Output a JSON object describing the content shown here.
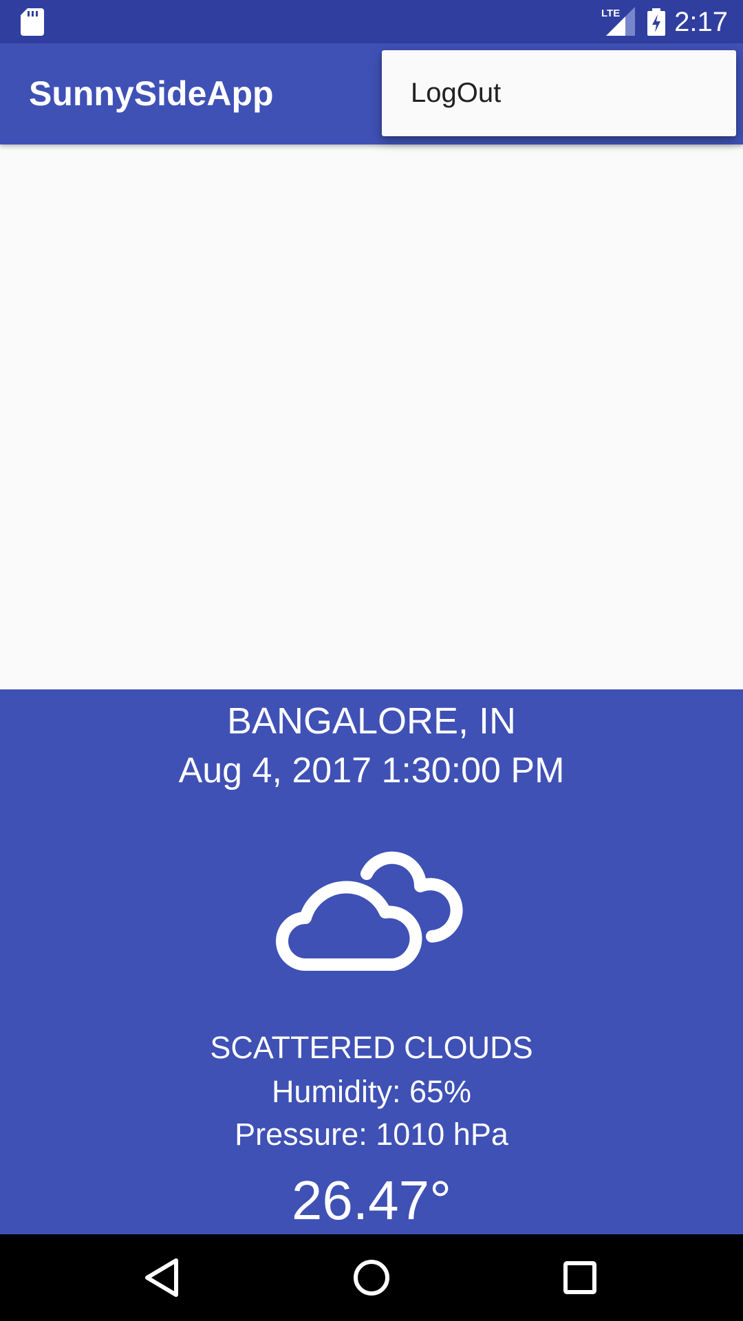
{
  "status_bar": {
    "time": "2:17",
    "network_label": "LTE",
    "icons": [
      "sd-card-icon",
      "lte-signal-icon",
      "battery-charging-icon"
    ]
  },
  "app_bar": {
    "title": "SunnySideApp"
  },
  "overflow_menu": {
    "items": [
      {
        "label": "LogOut"
      }
    ]
  },
  "weather": {
    "city": "BANGALORE, IN",
    "date_time": "Aug 4, 2017 1:30:00 PM",
    "icon": "scattered-clouds-icon",
    "description": "SCATTERED CLOUDS",
    "humidity": "Humidity: 65%",
    "pressure": "Pressure: 1010 hPa",
    "temperature": "26.47°"
  },
  "nav_bar": {
    "buttons": [
      "back-icon",
      "home-icon",
      "recents-icon"
    ]
  },
  "colors": {
    "primary": "#3f51b5",
    "primary_dark": "#303f9f",
    "background": "#fafafa",
    "menu_text": "#212121",
    "on_primary": "#ffffff"
  }
}
